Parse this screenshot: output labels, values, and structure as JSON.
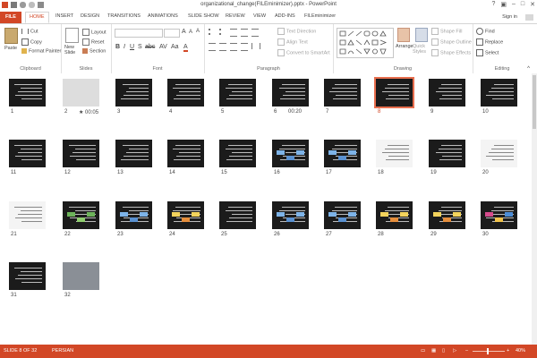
{
  "window": {
    "title": "organizational_change(FILEminimizer).pptx - PowerPoint",
    "signin": "Sign in"
  },
  "colors": {
    "accent": "#d24726",
    "thumb_bg": "#1b1b1b",
    "selection": "#e86e4e"
  },
  "tabs": [
    "FILE",
    "HOME",
    "INSERT",
    "DESIGN",
    "TRANSITIONS",
    "ANIMATIONS",
    "SLIDE SHOW",
    "REVIEW",
    "VIEW",
    "ADD-INS",
    "FILEminimizer"
  ],
  "clipboard": {
    "paste": "Paste",
    "cut": "Cut",
    "copy": "Copy",
    "format_painter": "Format Painter",
    "label": "Clipboard"
  },
  "slides_group": {
    "new_slide": "New Slide",
    "layout": "Layout",
    "reset": "Reset",
    "section": "Section",
    "label": "Slides"
  },
  "font": {
    "label": "Font"
  },
  "paragraph": {
    "text_direction": "Text Direction",
    "align_text": "Align Text",
    "convert": "Convert to SmartArt",
    "label": "Paragraph"
  },
  "drawing": {
    "arrange": "Arrange",
    "quick_styles": "Quick Styles",
    "shape_fill": "Shape Fill",
    "shape_outline": "Shape Outline",
    "shape_effects": "Shape Effects",
    "label": "Drawing"
  },
  "editing": {
    "find": "Find",
    "replace": "Replace",
    "select": "Select",
    "label": "Editing"
  },
  "slides": [
    {
      "n": "1",
      "extra": ""
    },
    {
      "n": "2",
      "extra": "★ 00:05"
    },
    {
      "n": "3",
      "extra": ""
    },
    {
      "n": "4",
      "extra": ""
    },
    {
      "n": "5",
      "extra": ""
    },
    {
      "n": "6",
      "extra": "00:20"
    },
    {
      "n": "7",
      "extra": ""
    },
    {
      "n": "8",
      "extra": ""
    },
    {
      "n": "9",
      "extra": ""
    },
    {
      "n": "10",
      "extra": ""
    },
    {
      "n": "11",
      "extra": ""
    },
    {
      "n": "12",
      "extra": ""
    },
    {
      "n": "13",
      "extra": ""
    },
    {
      "n": "14",
      "extra": ""
    },
    {
      "n": "15",
      "extra": ""
    },
    {
      "n": "16",
      "extra": ""
    },
    {
      "n": "17",
      "extra": ""
    },
    {
      "n": "18",
      "extra": ""
    },
    {
      "n": "19",
      "extra": ""
    },
    {
      "n": "20",
      "extra": ""
    },
    {
      "n": "21",
      "extra": ""
    },
    {
      "n": "22",
      "extra": ""
    },
    {
      "n": "23",
      "extra": ""
    },
    {
      "n": "24",
      "extra": ""
    },
    {
      "n": "25",
      "extra": ""
    },
    {
      "n": "26",
      "extra": ""
    },
    {
      "n": "27",
      "extra": ""
    },
    {
      "n": "28",
      "extra": ""
    },
    {
      "n": "29",
      "extra": ""
    },
    {
      "n": "30",
      "extra": ""
    },
    {
      "n": "31",
      "extra": ""
    },
    {
      "n": "32",
      "extra": ""
    }
  ],
  "selected_slide": "8",
  "status": {
    "slide_of": "SLIDE 8 OF 32",
    "language": "PERSIAN",
    "zoom": "40%"
  }
}
